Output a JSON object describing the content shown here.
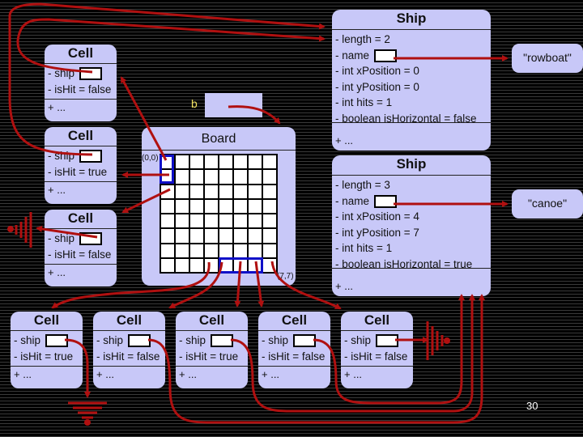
{
  "ship1": {
    "title": "Ship",
    "attrs": [
      "- length = 2",
      "- name",
      "- int xPosition = 0",
      "- int yPosition = 0",
      "- int hits = 1",
      "- boolean isHorizontal = false"
    ],
    "ops": "+ ...",
    "name_value": "\"rowboat\""
  },
  "ship2": {
    "title": "Ship",
    "attrs": [
      "- length = 3",
      "- name",
      "- int xPosition = 4",
      "- int yPosition = 7",
      "- int hits = 1",
      "- boolean isHorizontal = true"
    ],
    "ops": "+ ...",
    "name_value": "\"canoe\""
  },
  "board": {
    "title": "Board",
    "ref_label": "b",
    "origin_label": "(0,0)",
    "corner_label": "(7,7)",
    "size": 8
  },
  "left_cells": [
    {
      "title": "Cell",
      "ship": "- ship",
      "isHit": "- isHit = false",
      "ops": "+ ..."
    },
    {
      "title": "Cell",
      "ship": "- ship",
      "isHit": "- isHit = true",
      "ops": "+ ..."
    },
    {
      "title": "Cell",
      "ship": "- ship",
      "isHit": "- isHit = false",
      "ops": "+ ..."
    }
  ],
  "bottom_cells": [
    {
      "title": "Cell",
      "ship": "- ship",
      "isHit": "- isHit = true",
      "ops": "+ ..."
    },
    {
      "title": "Cell",
      "ship": "- ship",
      "isHit": "- isHit = false",
      "ops": "+ ..."
    },
    {
      "title": "Cell",
      "ship": "- ship",
      "isHit": "- isHit = true",
      "ops": "+ ..."
    },
    {
      "title": "Cell",
      "ship": "- ship",
      "isHit": "- isHit = false",
      "ops": "+ ..."
    },
    {
      "title": "Cell",
      "ship": "- ship",
      "isHit": "- isHit = false",
      "ops": "+ ..."
    }
  ],
  "page_number": "30",
  "colors": {
    "box": "#c8c8f8",
    "arrow": "#b01010",
    "highlight": "#1010c8",
    "ref_label": "#f0e060"
  }
}
